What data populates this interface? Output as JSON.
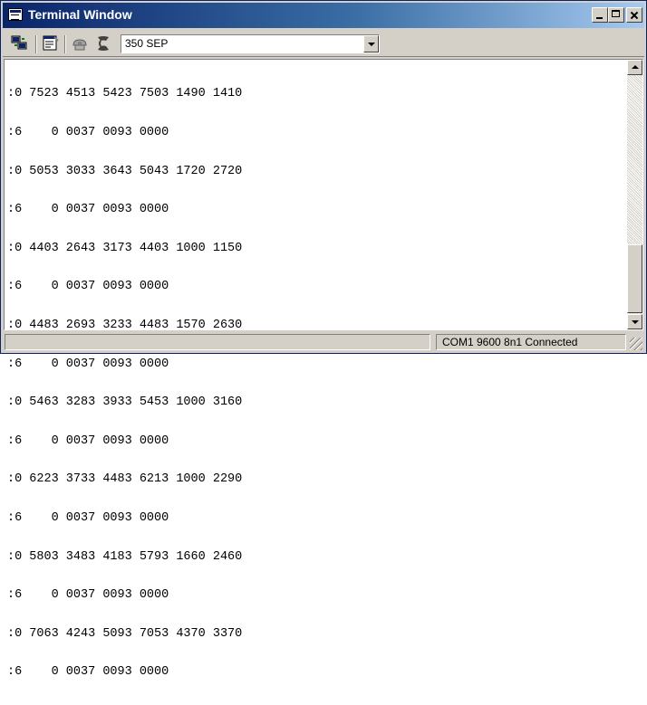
{
  "window": {
    "title": "Terminal Window"
  },
  "toolbar": {
    "buttons": [
      {
        "icon": "connect-icon"
      },
      {
        "icon": "properties-icon"
      },
      {
        "icon": "phone-icon"
      },
      {
        "icon": "dial-icon"
      }
    ],
    "device_select": {
      "value": "350 SEP"
    }
  },
  "terminal": {
    "lines": [
      ":0 7523 4513 5423 7503 1490 1410",
      ":6    0 0037 0093 0000",
      ":0 5053 3033 3643 5043 1720 2720",
      ":6    0 0037 0093 0000",
      ":0 4403 2643 3173 4403 1000 1150",
      ":6    0 0037 0093 0000",
      ":0 4483 2693 3233 4483 1570 2630",
      ":6    0 0037 0093 0000",
      ":0 5463 3283 3933 5453 1000 3160",
      ":6    0 0037 0093 0000",
      ":0 6223 3733 4483 6213 1000 2290",
      ":6    0 0037 0093 0000",
      ":0 5803 3483 4183 5793 1660 2460",
      ":6    0 0037 0093 0000",
      ":0 7063 4243 5093 7053 4370 3370",
      ":6    0 0037 0093 0000"
    ]
  },
  "statusbar": {
    "connection": "COM1 9600 8n1  Connected"
  },
  "colors": {
    "title_gradient_start": "#0a246a",
    "title_gradient_end": "#a6caf0",
    "chrome": "#d4d0c8",
    "terminal_bg": "#ffffff"
  }
}
